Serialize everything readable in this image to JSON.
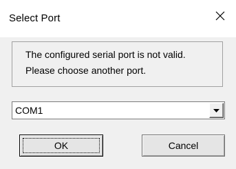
{
  "window": {
    "title": "Select Port",
    "close_icon": "close-icon"
  },
  "message": {
    "line1": "The configured serial port is not valid.",
    "line2": "Please choose another port."
  },
  "port_select": {
    "selected": "COM1",
    "arrow_icon": "chevron-down-icon"
  },
  "buttons": {
    "ok_label": "OK",
    "cancel_label": "Cancel"
  },
  "colors": {
    "dialog_bg": "#f0f0f0",
    "titlebar_bg": "#ffffff"
  }
}
